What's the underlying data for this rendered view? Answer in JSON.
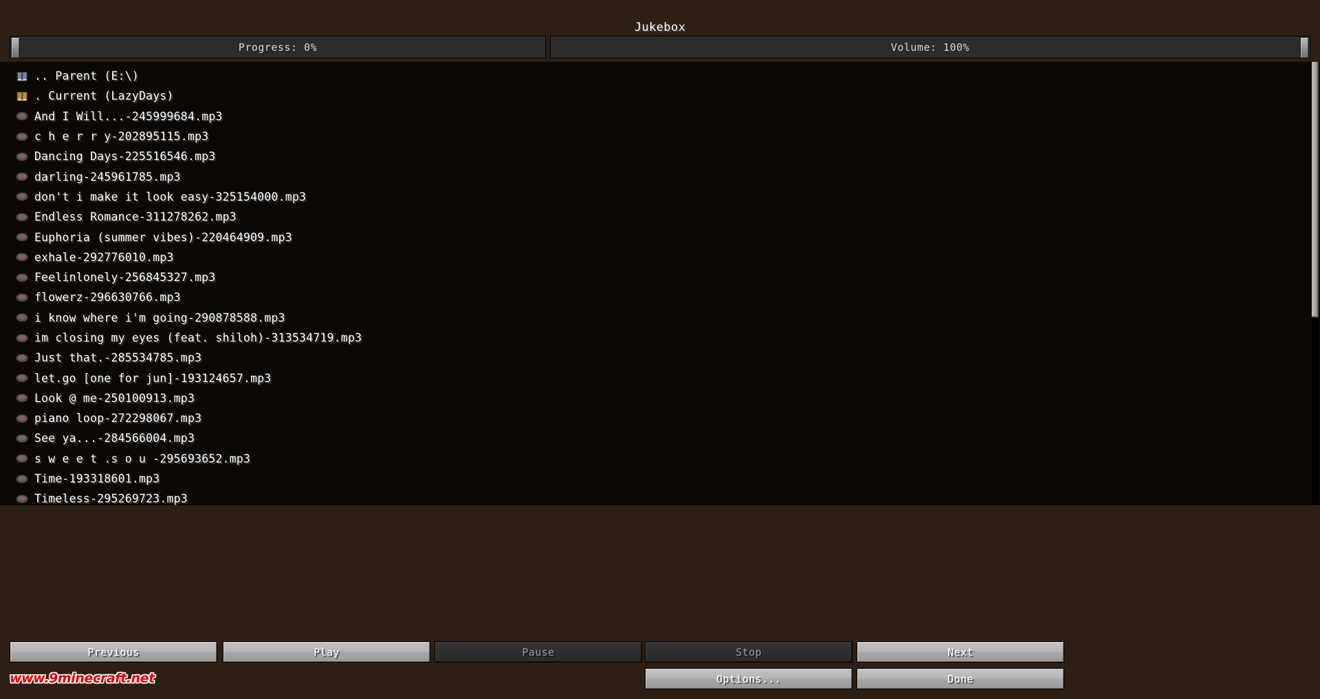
{
  "window": {
    "title": "Jukebox"
  },
  "sliders": {
    "progress": {
      "label": "Progress: 0%",
      "value": 0,
      "handle_position": "left"
    },
    "volume": {
      "label": "Volume: 100%",
      "value": 100,
      "handle_position": "right"
    }
  },
  "file_browser": {
    "entries": [
      {
        "icon": "book-blue-icon",
        "label": ".. Parent (E:\\)"
      },
      {
        "icon": "book-brown-icon",
        "label": ". Current (LazyDays)"
      },
      {
        "icon": "music-disc-icon",
        "label": "And I Will...-245999684.mp3"
      },
      {
        "icon": "music-disc-icon",
        "label": "c h e r r y-202895115.mp3"
      },
      {
        "icon": "music-disc-icon",
        "label": "Dancing Days-225516546.mp3"
      },
      {
        "icon": "music-disc-icon",
        "label": "darling-245961785.mp3"
      },
      {
        "icon": "music-disc-icon",
        "label": "don't i make it look easy-325154000.mp3"
      },
      {
        "icon": "music-disc-icon",
        "label": "Endless Romance-311278262.mp3"
      },
      {
        "icon": "music-disc-icon",
        "label": "Euphoria (summer vibes)-220464909.mp3"
      },
      {
        "icon": "music-disc-icon",
        "label": "exhale-292776010.mp3"
      },
      {
        "icon": "music-disc-icon",
        "label": "Feelinlonely-256845327.mp3"
      },
      {
        "icon": "music-disc-icon",
        "label": "flowerz-296630766.mp3"
      },
      {
        "icon": "music-disc-icon",
        "label": "i know where i'm going-290878588.mp3"
      },
      {
        "icon": "music-disc-icon",
        "label": "im closing my eyes (feat. shiloh)-313534719.mp3"
      },
      {
        "icon": "music-disc-icon",
        "label": "Just that.-285534785.mp3"
      },
      {
        "icon": "music-disc-icon",
        "label": "let.go [one for jun]-193124657.mp3"
      },
      {
        "icon": "music-disc-icon",
        "label": "Look @ me-250100913.mp3"
      },
      {
        "icon": "music-disc-icon",
        "label": "piano loop-272298067.mp3"
      },
      {
        "icon": "music-disc-icon",
        "label": "See ya...-284566004.mp3"
      },
      {
        "icon": "music-disc-icon",
        "label": "s w e e t .s o u -295693652.mp3"
      },
      {
        "icon": "music-disc-icon",
        "label": "Time-193318601.mp3"
      },
      {
        "icon": "music-disc-icon",
        "label": "Timeless-295269723.mp3"
      }
    ]
  },
  "controls": {
    "previous": {
      "label": "Previous",
      "enabled": true
    },
    "play": {
      "label": "Play",
      "enabled": true
    },
    "pause": {
      "label": "Pause",
      "enabled": false
    },
    "stop": {
      "label": "Stop",
      "enabled": false
    },
    "next": {
      "label": "Next",
      "enabled": true
    },
    "options": {
      "label": "Options...",
      "enabled": true
    },
    "done": {
      "label": "Done",
      "enabled": true
    }
  },
  "watermark": {
    "text": "www.9minecraft.net"
  },
  "colors": {
    "background": "#2e1f15",
    "panel": "#000000",
    "button_enabled": "#b6b6b6",
    "button_disabled": "#2f2f2f",
    "text": "#ffffff",
    "watermark": "#e00000"
  }
}
